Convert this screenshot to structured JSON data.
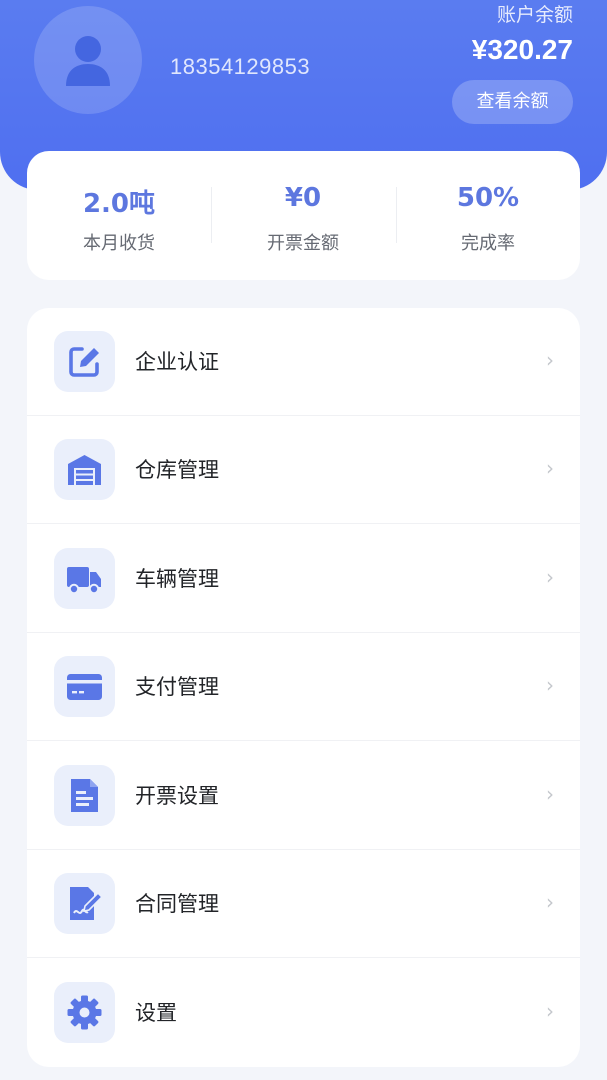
{
  "header": {
    "phone": "18354129853",
    "balance_label": "账户余额",
    "balance_value": "¥320.27",
    "view_balance_label": "查看余额"
  },
  "stats": [
    {
      "value": "2.0吨",
      "label": "本月收货"
    },
    {
      "value": "¥0",
      "label": "开票金额"
    },
    {
      "value": "50%",
      "label": "完成率"
    }
  ],
  "menu": [
    {
      "label": "企业认证",
      "icon": "edit-icon"
    },
    {
      "label": "仓库管理",
      "icon": "warehouse-icon"
    },
    {
      "label": "车辆管理",
      "icon": "truck-icon"
    },
    {
      "label": "支付管理",
      "icon": "card-icon"
    },
    {
      "label": "开票设置",
      "icon": "invoice-icon"
    },
    {
      "label": "合同管理",
      "icon": "contract-icon"
    },
    {
      "label": "设置",
      "icon": "gear-icon"
    }
  ],
  "colors": {
    "accent": "#5a7cf0",
    "icon": "#5a77e6",
    "icon_bg": "#eaeffb"
  }
}
